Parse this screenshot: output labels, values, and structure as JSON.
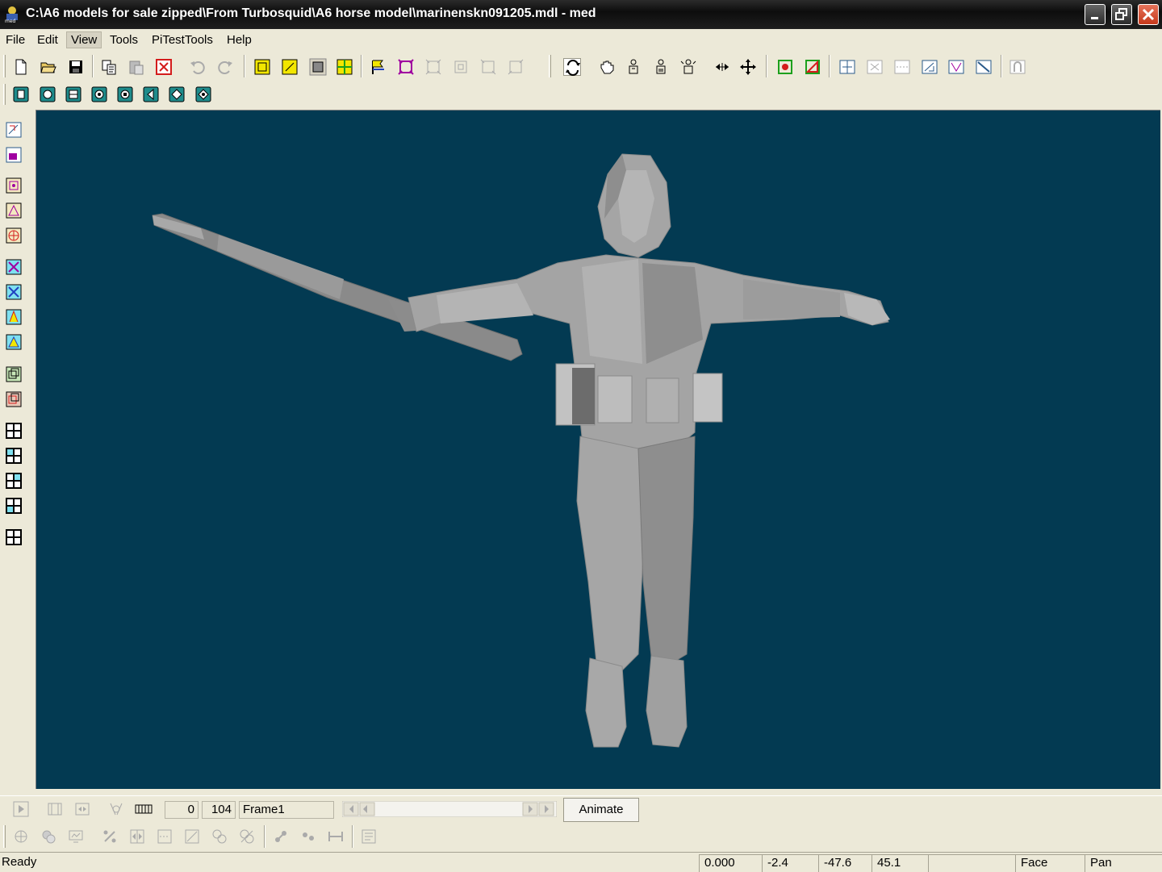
{
  "window": {
    "title": "C:\\A6 models for sale zipped\\From Turbosquid\\A6 horse model\\marinenskn091205.mdl - med",
    "icon": "med-app-icon",
    "controls": [
      "minimize-icon",
      "restore-icon",
      "close-icon"
    ]
  },
  "menu": {
    "items": [
      "File",
      "Edit",
      "View",
      "Tools",
      "PiTestTools",
      "Help"
    ],
    "active": "View"
  },
  "viewport": {
    "background": "#033a52",
    "model_color": "#9a9a9a"
  },
  "animation": {
    "start_frame": "0",
    "end_frame": "104",
    "frame_name": "Frame1",
    "animate_label": "Animate"
  },
  "status": {
    "ready": "Ready",
    "value1": "0.000",
    "x": "-2.4",
    "y": "-47.6",
    "z": "45.1",
    "empty": "",
    "mode": "Face",
    "tool": "Pan"
  },
  "colors": {
    "accent_yellow": "#f2e600",
    "accent_teal": "#1f8c8c",
    "accent_red": "#d41c1c",
    "accent_green": "#1ca01c"
  }
}
